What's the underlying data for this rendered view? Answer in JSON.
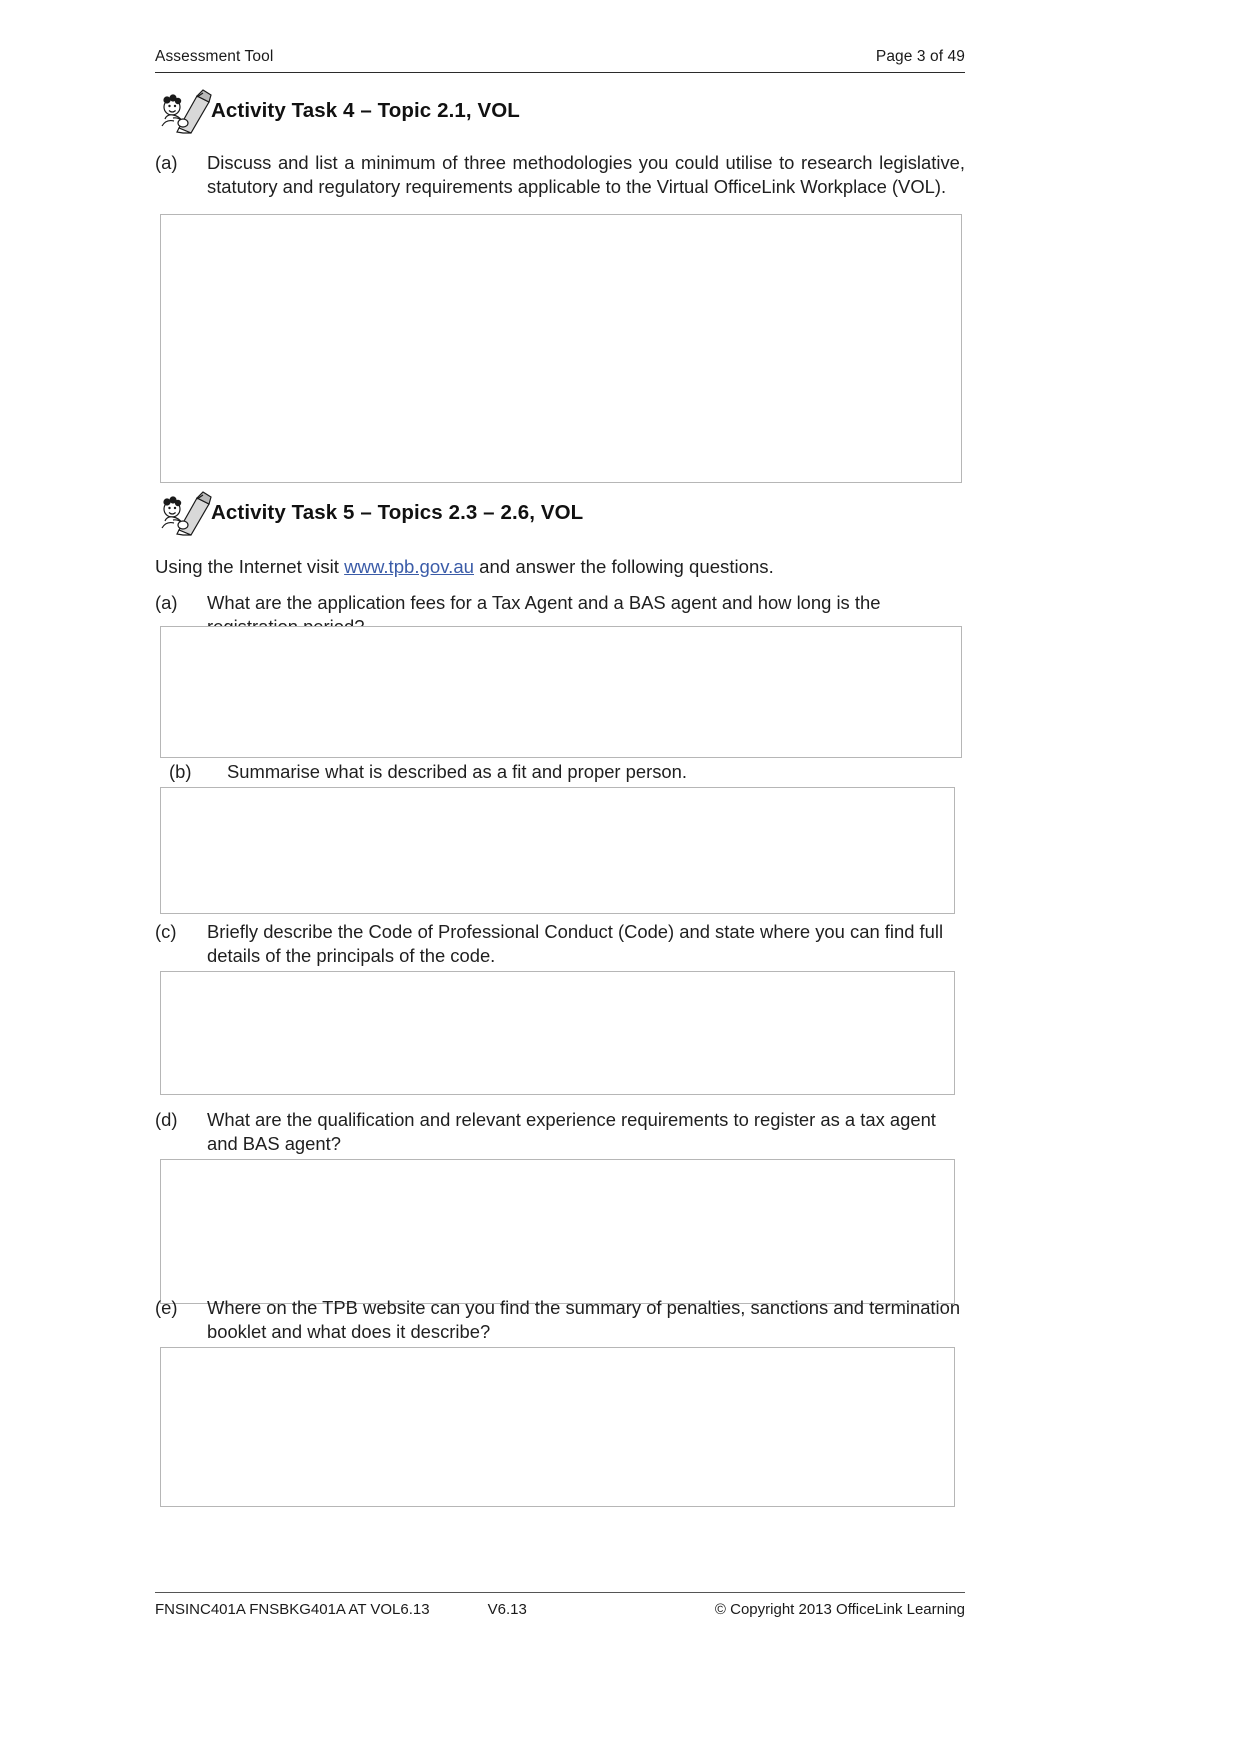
{
  "header": {
    "left": "Assessment Tool",
    "right": "Page 3 of 49"
  },
  "footer": {
    "code": "FNSINC401A FNSBKG401A AT VOL6.13",
    "version": "V6.13",
    "copyright": "© Copyright 2013 OfficeLink Learning"
  },
  "task4": {
    "title": "Activity Task 4 – Topic 2.1, VOL",
    "icon": "pencil-writer-icon",
    "question_a": {
      "label": "(a)",
      "line1": "Discuss and list a minimum of three methodologies you could utilise to research",
      "line2": "legislative, statutory and regulatory requirements applicable to the Virtual",
      "line3": "OfficeLink Workplace (VOL)."
    }
  },
  "task5": {
    "title": "Activity Task 5 – Topics 2.3 – 2.6, VOL",
    "icon": "pencil-writer-icon",
    "intro": {
      "before_link": "Using the Internet visit ",
      "link_text": "www.tpb.gov.au",
      "after_link": " and answer the following questions."
    },
    "questions": [
      {
        "label": "(a)",
        "line1": "What are the application fees for a Tax Agent and a BAS agent and how long is",
        "line2": "the registration period?"
      },
      {
        "label": "(b)",
        "line1": "Summarise what is described as a fit and proper person.",
        "line2": ""
      },
      {
        "label": "(c)",
        "line1": "Briefly describe the Code of Professional Conduct (Code) and state where you",
        "line2": "can find full details of the principals of the code."
      },
      {
        "label": "(d)",
        "line1": "What are the qualification and relevant experience requirements to register as a",
        "line2": "tax agent and BAS agent?"
      },
      {
        "label": "(e)",
        "line1": "Where on the TPB website can you find the summary of penalties, sanctions and",
        "line2": "termination booklet and what does it describe?"
      }
    ]
  },
  "colors": {
    "link": "#3b5ca8",
    "box_border": "#b6b6b6",
    "rule": "#2b2b2b",
    "text": "#1f1f1f"
  }
}
